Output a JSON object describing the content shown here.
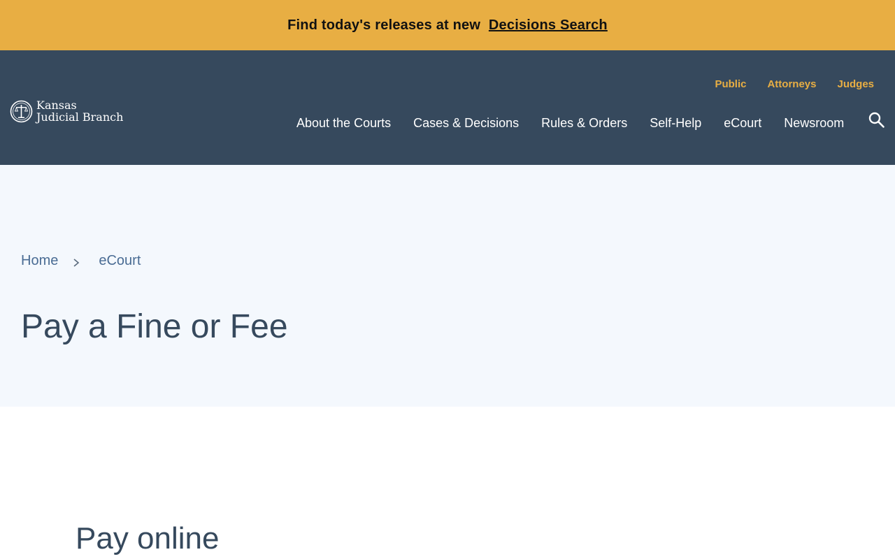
{
  "alert": {
    "text": "Find today's releases at new",
    "link_label": "Decisions Search"
  },
  "logo": {
    "line1": "Kansas",
    "line2": "Judicial Branch",
    "icon": "seal-icon"
  },
  "utility_nav": {
    "items": [
      {
        "label": "Public"
      },
      {
        "label": "Attorneys"
      },
      {
        "label": "Judges"
      }
    ]
  },
  "main_nav": {
    "items": [
      {
        "label": "About the Courts"
      },
      {
        "label": "Cases & Decisions"
      },
      {
        "label": "Rules & Orders"
      },
      {
        "label": "Self-Help"
      },
      {
        "label": "eCourt"
      },
      {
        "label": "Newsroom"
      }
    ],
    "search_icon": "search-icon"
  },
  "breadcrumb": {
    "items": [
      {
        "label": "Home"
      },
      {
        "label": "eCourt"
      }
    ]
  },
  "page": {
    "title": "Pay a Fine or Fee",
    "section_heading": "Pay online"
  },
  "colors": {
    "alert_bg": "#e8ae43",
    "header_bg": "#36495d",
    "utility_link": "#e8ae43",
    "hero_bg": "#f4f8fd",
    "breadcrumb_link": "#4a6c94",
    "title": "#36495d"
  }
}
